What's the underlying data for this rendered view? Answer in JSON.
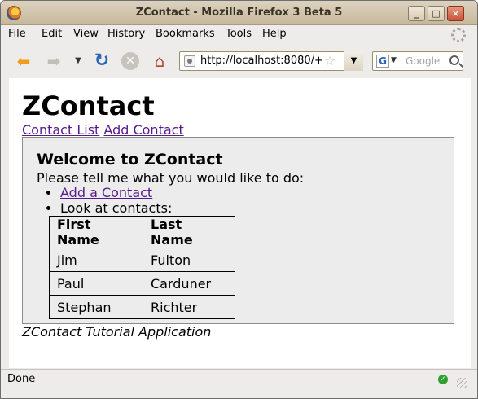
{
  "window": {
    "title": "ZContact - Mozilla Firefox 3 Beta 5"
  },
  "menu": {
    "items": [
      "File",
      "Edit",
      "View",
      "History",
      "Bookmarks",
      "Tools",
      "Help"
    ]
  },
  "toolbar": {
    "url": "http://localhost:8080/+",
    "search_placeholder": "Google",
    "search_engine": "G"
  },
  "page": {
    "title": "ZContact",
    "nav_links": [
      "Contact List",
      "Add Contact"
    ],
    "welcome_heading": "Welcome to ZContact",
    "prompt": "Please tell me what you would like to do:",
    "actions": {
      "add_contact": "Add a Contact",
      "look_at": "Look at contacts:"
    },
    "table": {
      "headers": [
        "First Name",
        "Last Name"
      ],
      "rows": [
        [
          "Jim",
          "Fulton"
        ],
        [
          "Paul",
          "Carduner"
        ],
        [
          "Stephan",
          "Richter"
        ]
      ]
    },
    "footer": "ZContact Tutorial Application"
  },
  "status": {
    "text": "Done"
  },
  "colors": {
    "visited_link": "#551a8b",
    "panel_bg": "#ececec",
    "status_ok": "#2da02d"
  }
}
